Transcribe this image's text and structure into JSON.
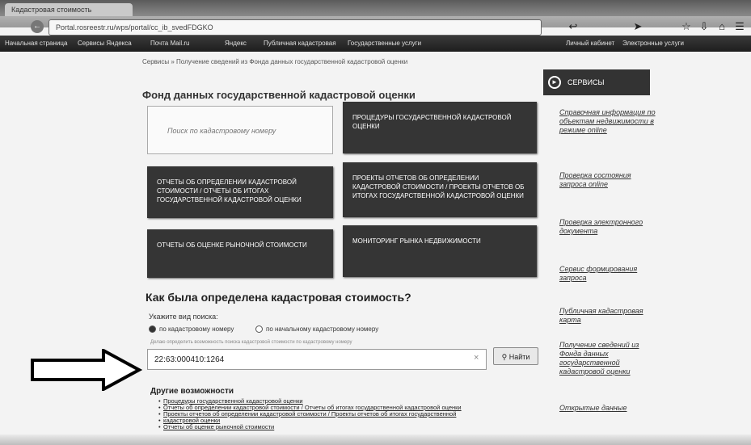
{
  "browser": {
    "tab_title": "Кадастровая стоимость",
    "address": "Portal.rosreestr.ru/wps/portal/cc_ib_svedFDGKO",
    "toolbar_icons": [
      "back-icon",
      "forward-icon",
      "star-icon",
      "download-icon",
      "home-icon",
      "menu-icon"
    ],
    "bookmarks": [
      "Начальная страница",
      "Сервисы Яндекса",
      "Почта Mail.ru",
      "Яндекс",
      "Публичная кадастровая",
      "Государственные услуги",
      "Личный кабинет",
      "Электронные услуги"
    ]
  },
  "breadcrumb": "Сервисы  »  Получение сведений из Фонда данных государственной кадастровой оценки",
  "main": {
    "title": "Фонд данных государственной кадастровой оценки",
    "search_placeholder": "Поиск по кадастровому номеру",
    "tiles": [
      "Процедуры государственной кадастровой оценки",
      "Отчеты об определении кадастровой стоимости / отчеты об итогах государственной кадастровой оценки",
      "Проекты отчетов об определении кадастровой стоимости / проекты отчетов об итогах государственной кадастровой оценки",
      "Отчеты об оценке рыночной стоимости",
      "Мониторинг рынка недвижимости"
    ],
    "section_title": "Как была определена кадастровая стоимость?",
    "search_type_label": "Укажите вид поиска:",
    "radio_options": [
      "по кадастровому номеру",
      "по начальному кадастровому номеру"
    ],
    "hint": "Делаю определить возможность поиска кадастровой стоимости по кадастровому номеру",
    "cadastral_number": "22:63:000410:1264",
    "find_label": "Найти",
    "other_title": "Другие возможности",
    "other_links": [
      "Процедуры государственной кадастровой оценки",
      "Отчеты об определении кадастровой стоимости / Отчеты об итогах государственной кадастровой оценки",
      "Проекты отчетов об определении кадастровой стоимости / Проекты отчетов об итогах государственной",
      "кадастровой оценки",
      "Отчеты об оценке рыночной стоимости"
    ]
  },
  "sidebar": {
    "header": "СЕРВИСЫ",
    "links": [
      "Справочная информация по объектам недвижимости в режиме online",
      "Проверка состояния запроса online",
      "Проверка электронного документа",
      "Сервис формирования запроса",
      "Публичная кадастровая карта",
      "Получение сведений из Фонда данных государственной кадастровой оценки",
      "Открытые данные"
    ]
  }
}
